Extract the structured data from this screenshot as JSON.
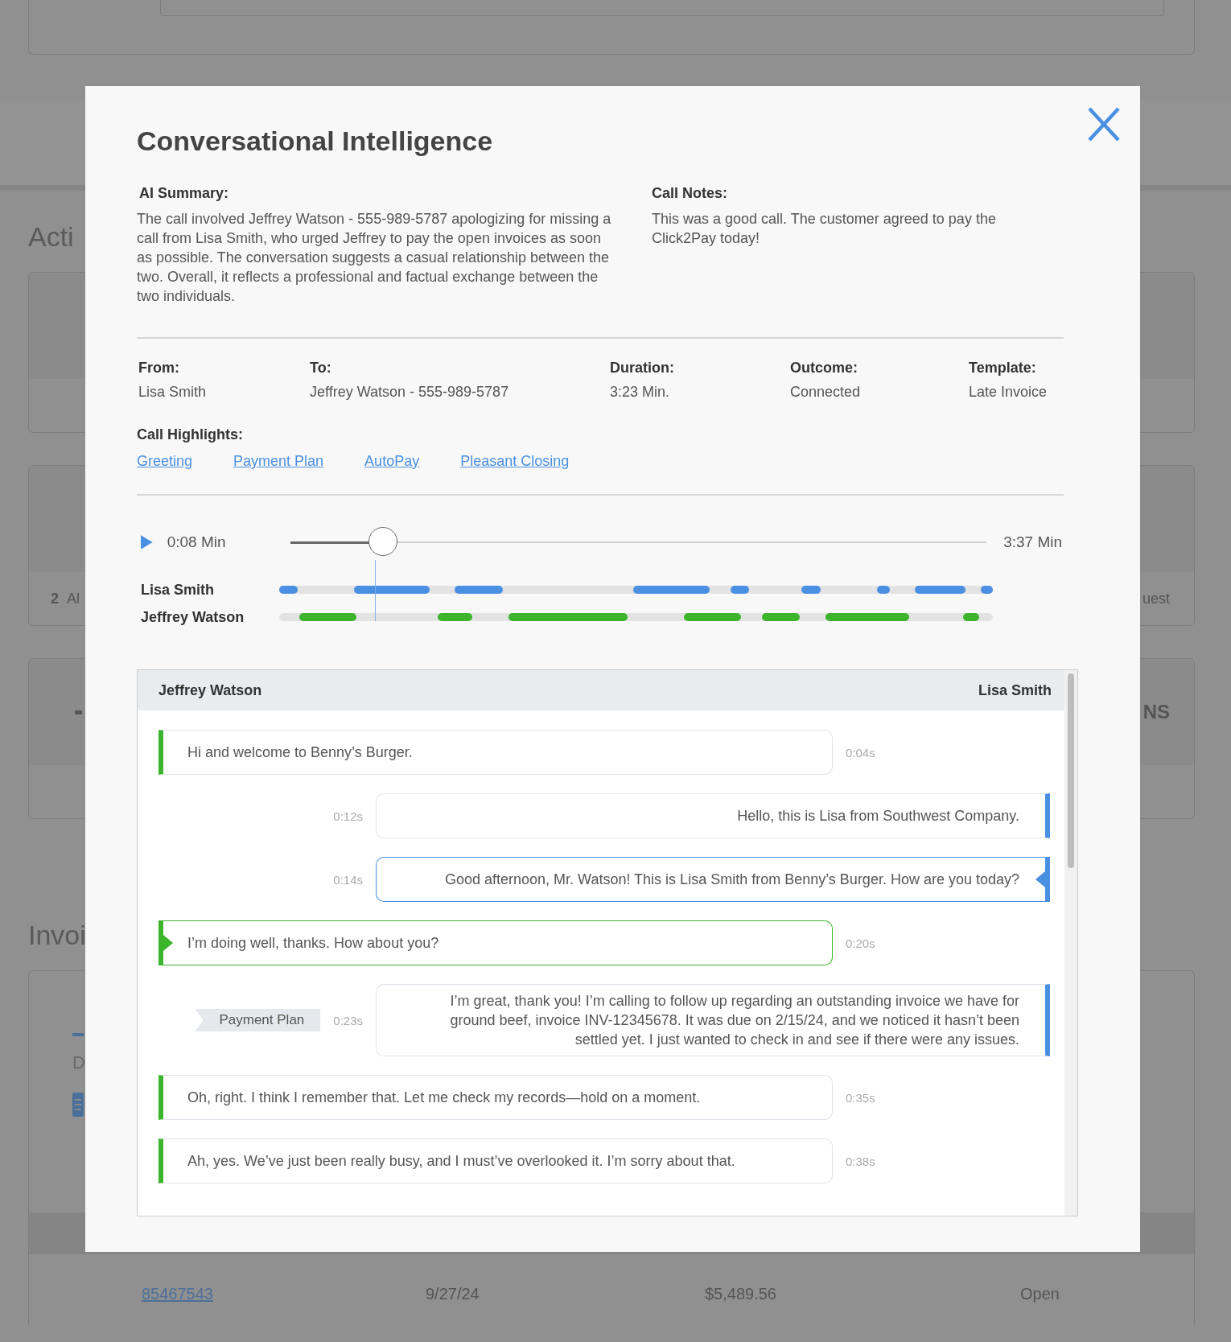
{
  "background": {
    "heading_1": "Acti",
    "card_2_count": "2",
    "card_2_label": "Al",
    "card_2_right": "uest",
    "card_3_right": "NS",
    "heading_2": "Invoi",
    "card_4_text": "D",
    "invoice_row": {
      "number": "85467543",
      "date": "9/27/24",
      "amount": "$5,489.56",
      "status": "Open"
    }
  },
  "modal": {
    "title": "Conversational Intelligence",
    "summary": {
      "label": "AI Summary:",
      "text": "The call involved Jeffrey Watson - 555-989-5787 apologizing for missing a call from Lisa Smith, who urged Jeffrey to pay the open invoices as soon as possible. The conversation suggests a casual relationship between the two. Overall, it reflects a professional and factual exchange between the two individuals."
    },
    "notes": {
      "label": "Call Notes:",
      "text": "This was a good call. The customer agreed to pay the Click2Pay today!"
    },
    "details": [
      {
        "label": "From:",
        "value": "Lisa Smith"
      },
      {
        "label": "To:",
        "value": "Jeffrey Watson - 555-989-5787"
      },
      {
        "label": "Duration:",
        "value": "3:23 Min."
      },
      {
        "label": "Outcome:",
        "value": "Connected"
      },
      {
        "label": "Template:",
        "value": "Late Invoice"
      }
    ],
    "highlights": {
      "label": "Call Highlights:",
      "links": [
        "Greeting",
        "Payment Plan",
        "AutoPay",
        "Pleasant Closing"
      ]
    },
    "player": {
      "current": "0:08 Min",
      "total": "3:37 Min",
      "level": 0.133
    },
    "tracks": [
      {
        "speaker": "Lisa Smith",
        "kind": "agent"
      },
      {
        "speaker": "Jeffrey Watson",
        "kind": "caller"
      }
    ],
    "transcript": {
      "left_header": "Jeffrey Watson",
      "right_header": "Lisa Smith",
      "messages": [
        {
          "kind": "caller",
          "text": "Hi and welcome to Benny’s Burger.",
          "time": "0:04s",
          "active": false
        },
        {
          "kind": "agent",
          "text": "Hello, this is Lisa from Southwest Company.",
          "time": "0:12s",
          "active": false
        },
        {
          "kind": "agent",
          "text": "Good afternoon, Mr. Watson! This is Lisa Smith from Benny’s Burger. How are you today?",
          "time": "0:14s",
          "active": true
        },
        {
          "kind": "caller",
          "text": "I’m doing well, thanks. How about you?",
          "time": "0:20s",
          "active": true
        },
        {
          "kind": "agent",
          "text": "I’m great, thank you! I’m calling to follow up regarding an outstanding invoice we have for ground beef, invoice INV-12345678. It was due on 2/15/24, and we noticed it hasn’t been settled yet. I just wanted to check in and see if there were any issues.",
          "time": "0:23s",
          "active": false,
          "tag": "Payment Plan"
        },
        {
          "kind": "caller",
          "text": "Oh, right. I think I remember that. Let me check my records—hold on a moment.",
          "time": "0:35s",
          "active": false
        },
        {
          "kind": "caller",
          "text": "Ah, yes. We’ve just been really busy, and I must’ve overlooked it. I’m sorry about that.",
          "time": "0:38s",
          "active": false
        }
      ]
    }
  }
}
